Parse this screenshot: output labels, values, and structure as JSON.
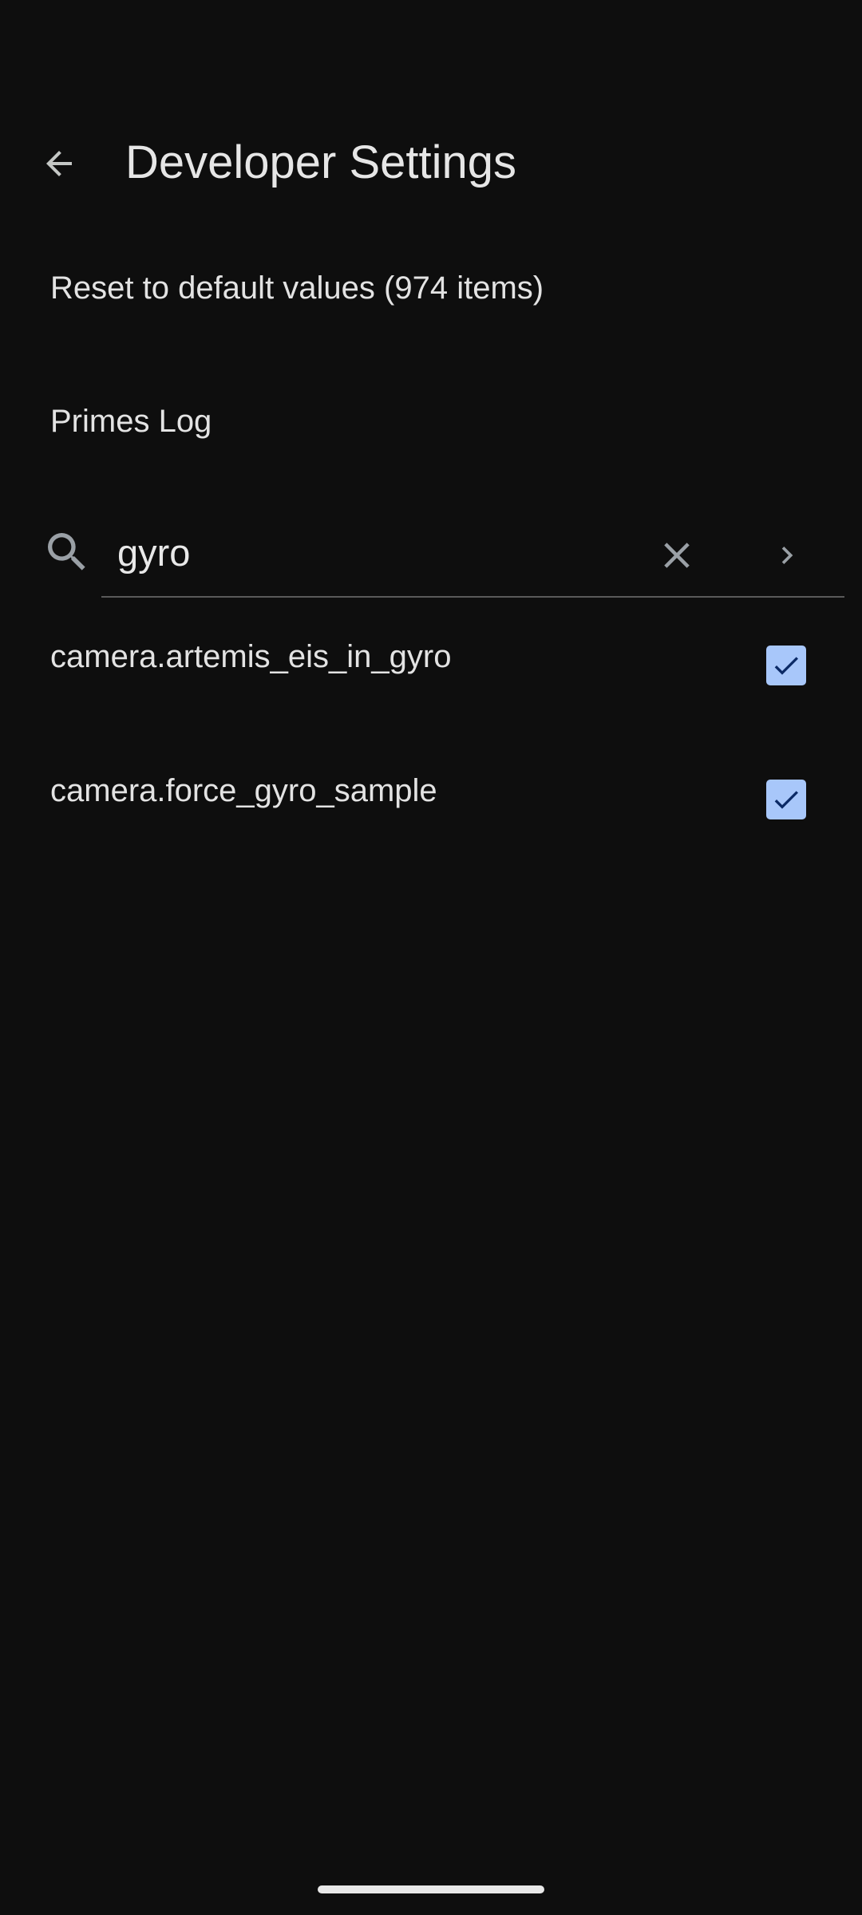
{
  "header": {
    "title": "Developer Settings",
    "back_icon": "arrow-back-icon"
  },
  "menu": {
    "reset_label": "Reset to default values (974 items)",
    "primes_label": "Primes Log"
  },
  "search": {
    "value": "gyro",
    "icons": {
      "search": "search-icon",
      "clear": "close-icon",
      "next": "chevron-right-icon"
    }
  },
  "results": [
    {
      "label": "camera.artemis_eis_in_gyro",
      "checked": true
    },
    {
      "label": "camera.force_gyro_sample",
      "checked": true
    }
  ],
  "colors": {
    "background": "#0e0e0e",
    "text": "#e3e3e3",
    "checkbox_fill": "#a8c7fa",
    "checkmark": "#0b2a66"
  }
}
